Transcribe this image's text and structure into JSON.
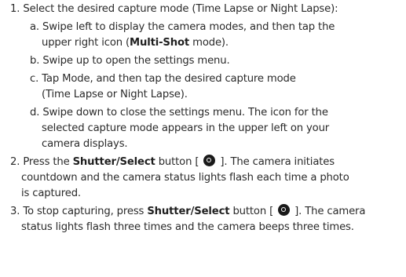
{
  "steps": [
    {
      "number": "1.",
      "line1": "Select the desired capture mode (Time Lapse or Night Lapse):",
      "substeps": [
        {
          "letter": "a.",
          "line1": "Swipe left to display the camera modes, and then tap the",
          "line2_pre": "upper right icon (",
          "line2_bold": "Multi-Shot",
          "line2_post": " mode)."
        },
        {
          "letter": "b.",
          "line1": "Swipe up to open the settings menu."
        },
        {
          "letter": "c.",
          "line1": "Tap Mode, and then tap the desired capture mode",
          "line2": "(Time Lapse or Night Lapse)."
        },
        {
          "letter": "d.",
          "line1": "Swipe down to close the settings menu. The icon for the",
          "line2": "selected capture mode appears in the upper left on your",
          "line3": "camera displays."
        }
      ]
    },
    {
      "number": "2.",
      "line1_pre": "Press the ",
      "line1_bold": "Shutter/Select",
      "line1_mid": " button [ ",
      "line1_post": " ]. The camera initiates",
      "line2": "countdown and the camera status lights flash each time a photo",
      "line3": "is  captured."
    },
    {
      "number": "3.",
      "line1_pre": "To stop capturing, press ",
      "line1_bold": "Shutter/Select",
      "line1_mid": " button [ ",
      "line1_post": " ]. The camera",
      "line2": "status lights flash three times and the camera beeps three times."
    }
  ],
  "icons": {
    "shutter": "shutter-button-icon"
  }
}
